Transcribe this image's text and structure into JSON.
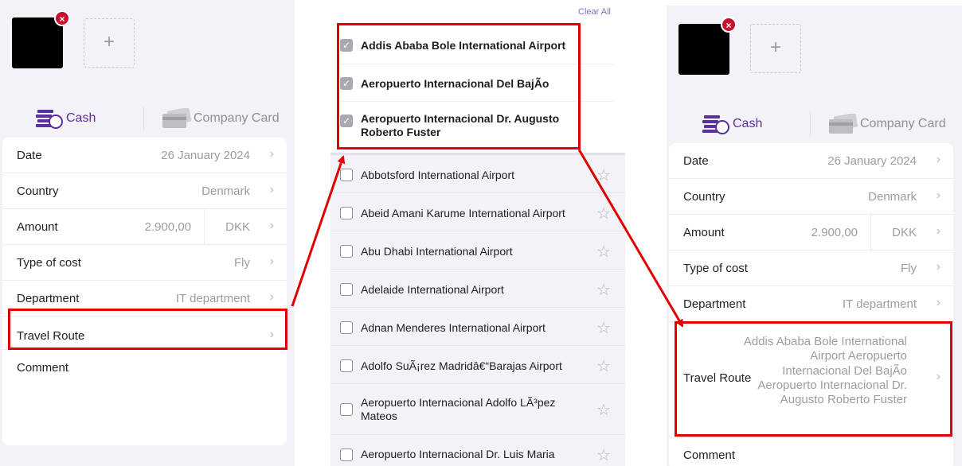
{
  "payment": {
    "cash_label": "Cash",
    "card_label": "Company Card"
  },
  "thumb": {
    "remove_glyph": "×",
    "add_glyph": "+"
  },
  "chevron": "›",
  "form": {
    "date": {
      "label": "Date",
      "value": "26 January 2024"
    },
    "country": {
      "label": "Country",
      "value": "Denmark"
    },
    "amount": {
      "label": "Amount",
      "value": "2.900,00",
      "currency": "DKK"
    },
    "type_of_cost": {
      "label": "Type of cost",
      "value": "Fly"
    },
    "department": {
      "label": "Department",
      "value": "IT department"
    },
    "travel_route": {
      "label": "Travel Route",
      "value": ""
    },
    "comment": {
      "label": "Comment"
    }
  },
  "picker": {
    "clear_all": "Clear All",
    "selected": [
      "Addis Ababa Bole International Airport",
      "Aeropuerto Internacional Del BajÃo",
      "Aeropuerto Internacional Dr. Augusto Roberto Fuster"
    ],
    "airports": [
      "Abbotsford International Airport",
      "Abeid Amani Karume International Airport",
      "Abu Dhabi International Airport",
      "Adelaide International Airport",
      "Adnan Menderes International Airport",
      "Adolfo SuÃ¡rez Madridâ€“Barajas Airport",
      "Aeropuerto Internacional Adolfo LÃ³pez Mateos",
      "Aeropuerto Internacional Dr. Luis Maria"
    ],
    "check_glyph": "✓",
    "star_glyph": "☆"
  },
  "result": {
    "travel_route_value": "Addis Ababa Bole International Airport Aeropuerto Internacional Del BajÃo Aeropuerto Internacional Dr. Augusto Roberto Fuster"
  },
  "colors": {
    "accent": "#5b2fa0",
    "highlight": "#e00000",
    "remove": "#c8102e"
  }
}
